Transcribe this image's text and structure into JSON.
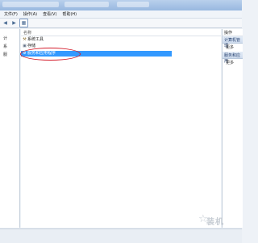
{
  "menubar": {
    "items": [
      "文件(F)",
      "操作(A)",
      "查看(V)",
      "帮助(H)"
    ]
  },
  "toolbar": {
    "icons": [
      "back-arrow-icon",
      "forward-arrow-icon",
      "panel-icon",
      "properties-icon",
      "help-icon"
    ]
  },
  "tree": {
    "items": [
      "计",
      "系",
      "服"
    ]
  },
  "list": {
    "column_name": "名称",
    "rows": [
      {
        "label": "系统工具",
        "icon": "tools-icon"
      },
      {
        "label": "存储",
        "icon": "storage-icon"
      },
      {
        "label": "服务和应用程序",
        "icon": "services-icon",
        "selected": true
      }
    ]
  },
  "actions_pane": {
    "title": "操作",
    "sections": [
      {
        "title": "计算机管理",
        "more": "更多"
      },
      {
        "title": "服务和应用",
        "more": "更多"
      }
    ]
  },
  "watermark": "装机",
  "colors": {
    "selection": "#3399ff",
    "annotation": "#d41c2b"
  }
}
